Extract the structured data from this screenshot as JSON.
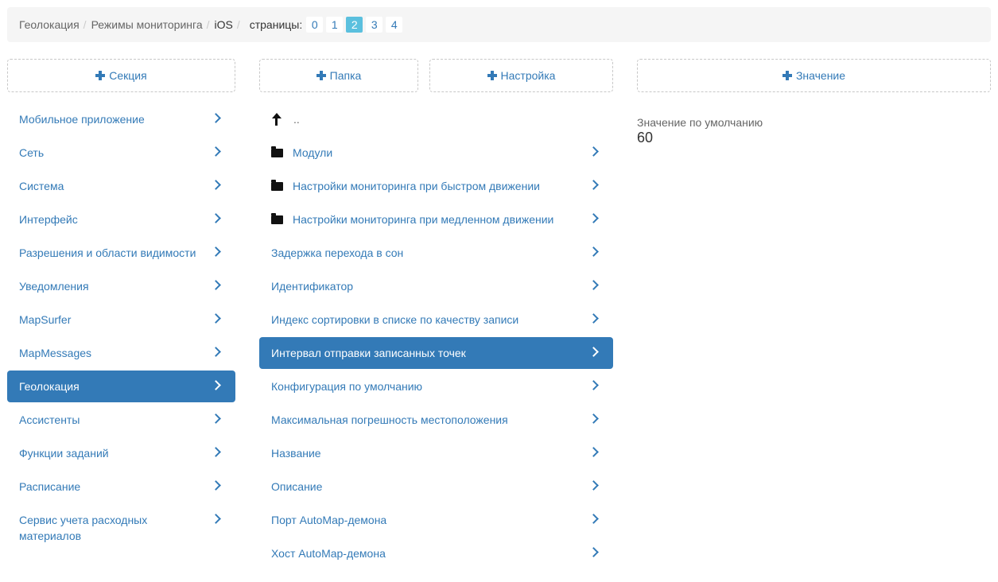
{
  "breadcrumb": {
    "items": [
      "Геолокация",
      "Режимы мониторинга"
    ],
    "current": "iOS",
    "pages_label": "страницы:",
    "pages": [
      "0",
      "1",
      "2",
      "3",
      "4"
    ],
    "active_page": "2"
  },
  "buttons": {
    "section": "Секция",
    "folder": "Папка",
    "setting": "Настройка",
    "value": "Значение"
  },
  "sections": [
    {
      "label": "Мобильное приложение"
    },
    {
      "label": "Сеть"
    },
    {
      "label": "Система"
    },
    {
      "label": "Интерфейс"
    },
    {
      "label": "Разрешения и области видимости"
    },
    {
      "label": "Уведомления"
    },
    {
      "label": "MapSurfer"
    },
    {
      "label": "MapMessages"
    },
    {
      "label": "Геолокация",
      "active": true
    },
    {
      "label": "Ассистенты"
    },
    {
      "label": "Функции заданий"
    },
    {
      "label": "Расписание"
    },
    {
      "label": "Сервис учета расходных материалов"
    }
  ],
  "settings": {
    "up_label": "..",
    "items": [
      {
        "label": "Модули",
        "folder": true
      },
      {
        "label": "Настройки мониторинга при быстром движении",
        "folder": true
      },
      {
        "label": "Настройки мониторинга при медленном движении",
        "folder": true
      },
      {
        "label": "Задержка перехода в сон"
      },
      {
        "label": "Идентификатор"
      },
      {
        "label": "Индекс сортировки в списке по качеству записи"
      },
      {
        "label": "Интервал отправки записанных точек",
        "active": true
      },
      {
        "label": "Конфигурация по умолчанию"
      },
      {
        "label": "Максимальная погрешность местоположения"
      },
      {
        "label": "Название"
      },
      {
        "label": "Описание"
      },
      {
        "label": "Порт AutoMap-демона"
      },
      {
        "label": "Хост AutoMap-демона"
      }
    ]
  },
  "value": {
    "label": "Значение по умолчанию",
    "value": "60"
  },
  "colors": {
    "accent": "#337ab7",
    "active_page": "#5bc0de",
    "breadcrumb_bg": "#f5f5f5"
  },
  "icons": {
    "add": "plus-icon",
    "chevron": "chevron-right-icon",
    "folder": "folder-icon",
    "up": "arrow-up-icon"
  }
}
